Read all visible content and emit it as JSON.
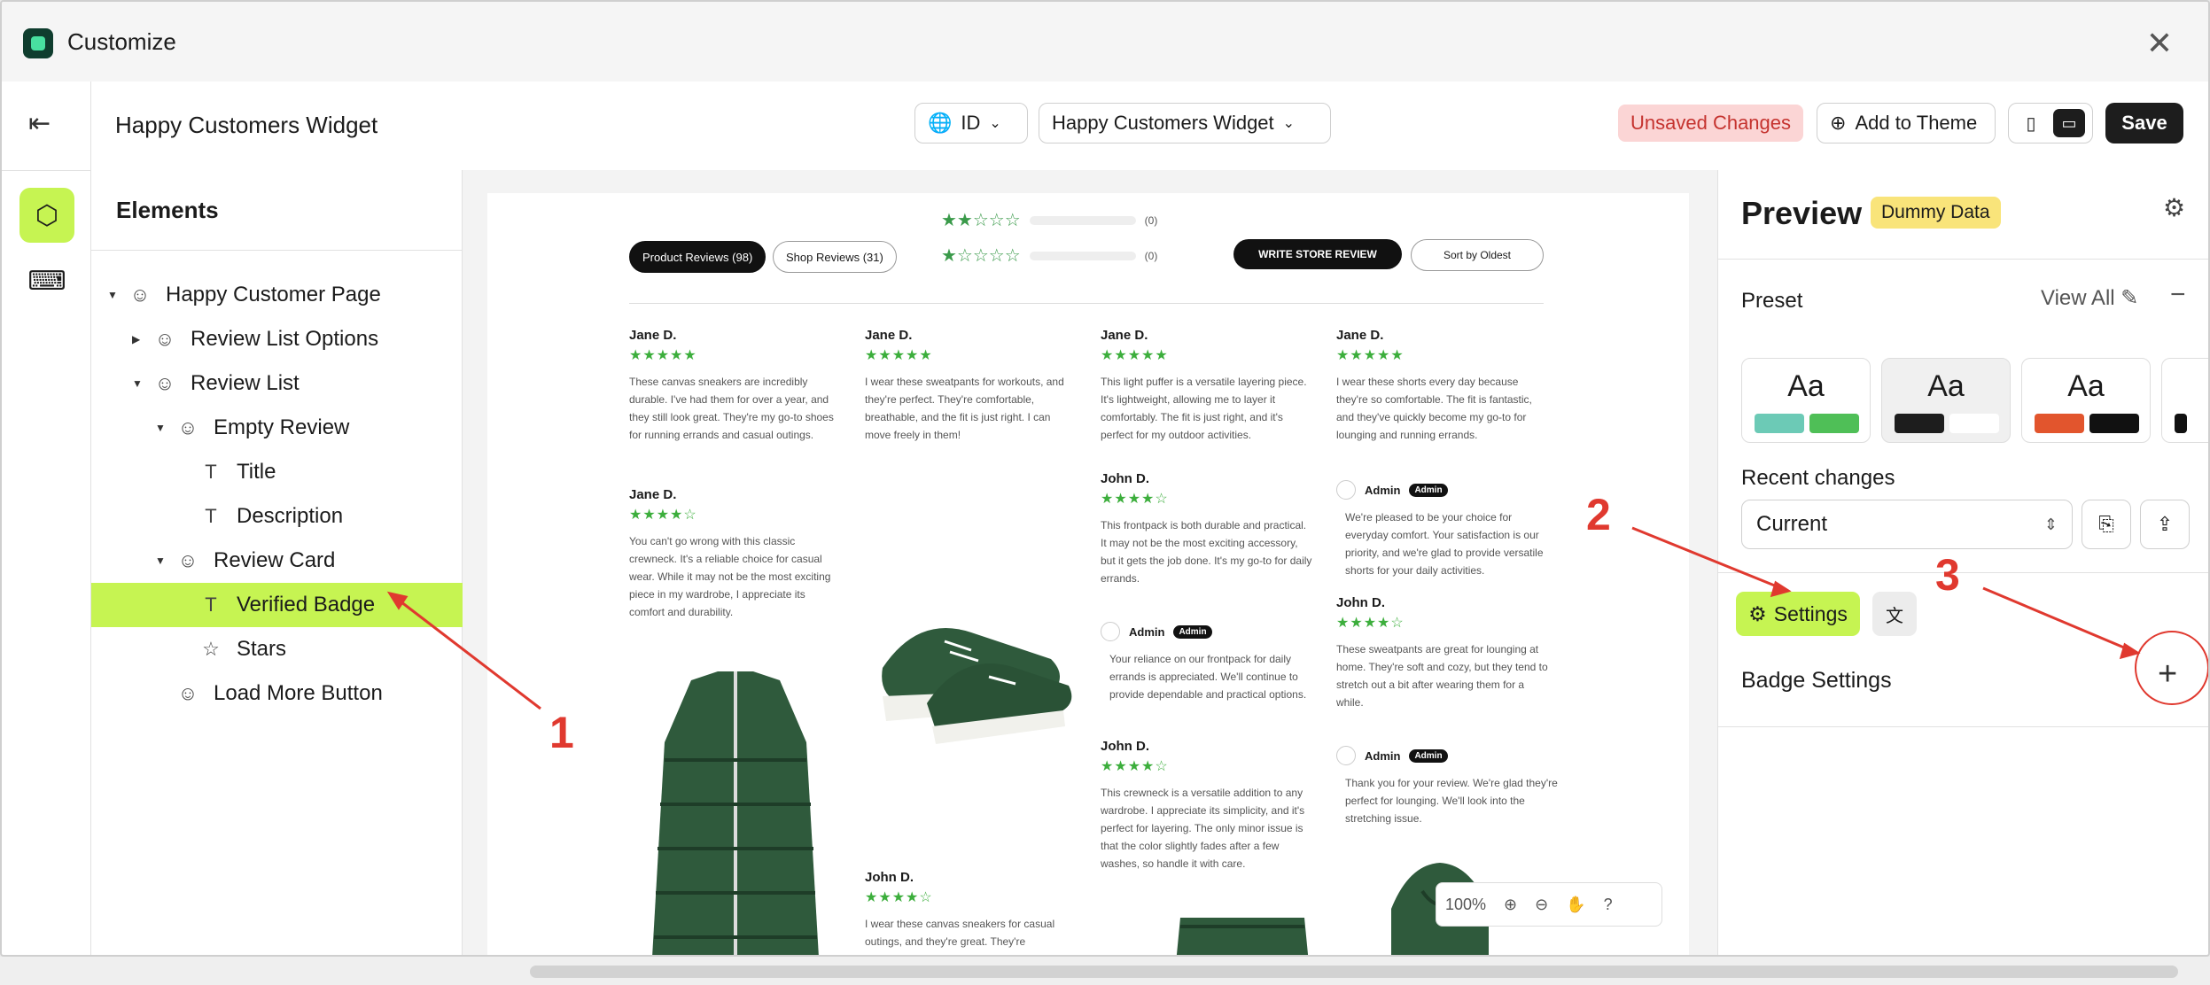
{
  "window": {
    "title": "Customize"
  },
  "toolbar": {
    "page_title": "Happy Customers Widget",
    "language": "ID",
    "widget_select": "Happy Customers Widget",
    "unsaved": "Unsaved Changes",
    "add_to_theme": "Add to Theme",
    "save": "Save"
  },
  "elements": {
    "heading": "Elements",
    "tree": [
      {
        "label": "Happy Customer Page"
      },
      {
        "label": "Review List Options"
      },
      {
        "label": "Review List"
      },
      {
        "label": "Empty Review"
      },
      {
        "label": "Title"
      },
      {
        "label": "Description"
      },
      {
        "label": "Review Card"
      },
      {
        "label": "Verified Badge"
      },
      {
        "label": "Stars"
      },
      {
        "label": "Load More Button"
      }
    ]
  },
  "preview_page": {
    "tab_product": "Product Reviews (98)",
    "tab_shop": "Shop Reviews (31)",
    "count_2": "(0)",
    "count_1": "(0)",
    "write": "WRITE STORE REVIEW",
    "sort": "Sort by Oldest",
    "reviews": [
      {
        "name": "Jane D.",
        "stars": "★★★★★",
        "text": "These canvas sneakers are incredibly durable. I've had them for over a year, and they still look great. They're my go-to shoes for running errands and casual outings."
      },
      {
        "name": "Jane D.",
        "stars": "★★★★☆",
        "text": "You can't go wrong with this classic crewneck. It's a reliable choice for casual wear. While it may not be the most exciting piece in my wardrobe, I appreciate its comfort and durability."
      },
      {
        "name": "Jane D.",
        "stars": "★★★★★",
        "text": "I wear these sweatpants for workouts, and they're perfect. They're comfortable, breathable, and the fit is just right. I can move freely in them!"
      },
      {
        "name": "John D.",
        "stars": "★★★★☆",
        "text": "I wear these canvas sneakers for casual outings, and they're great. They're"
      },
      {
        "name": "Jane D.",
        "stars": "★★★★★",
        "text": "This light puffer is a versatile layering piece. It's lightweight, allowing me to layer it comfortably. The fit is just right, and it's perfect for my outdoor activities."
      },
      {
        "name": "John D.",
        "stars": "★★★★☆",
        "text": "This frontpack is both durable and practical. It may not be the most exciting accessory, but it gets the job done. It's my go-to for daily errands."
      },
      {
        "name": "John D.",
        "stars": "★★★★☆",
        "text": "This crewneck is a versatile addition to any wardrobe. I appreciate its simplicity, and it's perfect for layering. The only minor issue is that the color slightly fades after a few washes, so handle it with care."
      },
      {
        "name": "Jane D.",
        "stars": "★★★★★",
        "text": "I wear these shorts every day because they're so comfortable. The fit is fantastic, and they've quickly become my go-to for lounging and running errands."
      },
      {
        "name": "John D.",
        "stars": "★★★★☆",
        "text": "These sweatpants are great for lounging at home. They're soft and cozy, but they tend to stretch out a bit after wearing them for a while."
      }
    ],
    "admin_name": "Admin",
    "admin_tag": "Admin",
    "admin_replies": [
      "Your reliance on our frontpack for daily errands is appreciated. We'll continue to provide dependable and practical options.",
      "We're pleased to be your choice for everyday comfort. Your satisfaction is our priority, and we're glad to provide versatile shorts for your daily activities.",
      "Thank you for your review. We're glad they're perfect for lounging. We'll look into the stretching issue."
    ],
    "zoom": "100%"
  },
  "right_panel": {
    "title": "Preview",
    "dummy": "Dummy Data",
    "preset": "Preset",
    "view_all": "View All",
    "preset_aa": "Aa",
    "recent_changes": "Recent changes",
    "current": "Current",
    "settings": "Settings",
    "badge_settings": "Badge Settings"
  },
  "annotations": {
    "a1": "1",
    "a2": "2",
    "a3": "3"
  },
  "colors": {
    "accent": "#c6f452",
    "annotation": "#e0392f",
    "star": "#3cae3c"
  }
}
